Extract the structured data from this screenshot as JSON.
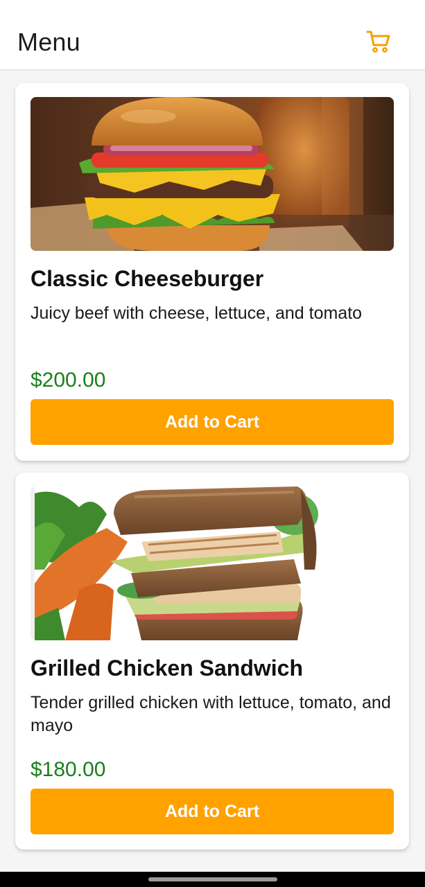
{
  "header": {
    "title": "Menu",
    "cart_icon": "cart-icon",
    "accent_color": "#f5a000"
  },
  "items": [
    {
      "name": "Classic Cheeseburger",
      "description": "Juicy beef with cheese, lettuce, and tomato",
      "price": "$200.00",
      "button_label": "Add to Cart",
      "image": "cheeseburger-photo"
    },
    {
      "name": "Grilled Chicken Sandwich",
      "description": "Tender grilled chicken with lettuce, tomato, and mayo",
      "price": "$180.00",
      "button_label": "Add to Cart",
      "image": "chicken-sandwich-photo"
    }
  ],
  "colors": {
    "button": "#ffa200",
    "price": "#1a7f1a",
    "button_text": "#ffffff"
  }
}
